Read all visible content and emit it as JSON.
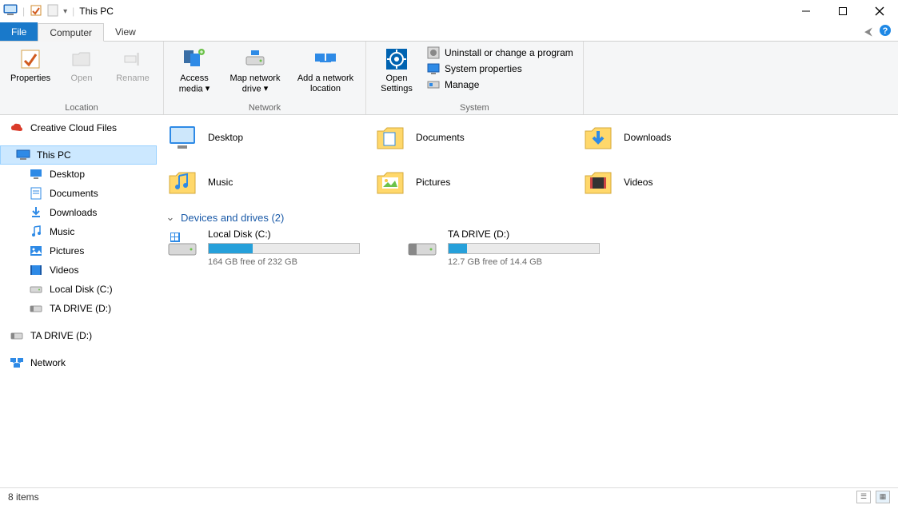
{
  "window": {
    "title": "This PC"
  },
  "tabs": {
    "file": "File",
    "computer": "Computer",
    "view": "View"
  },
  "ribbon": {
    "location": {
      "label": "Location",
      "properties": "Properties",
      "open": "Open",
      "rename": "Rename"
    },
    "network": {
      "label": "Network",
      "access_media": "Access media",
      "map_drive": "Map network drive",
      "add_location": "Add a network location"
    },
    "system": {
      "label": "System",
      "open_settings": "Open Settings",
      "uninstall": "Uninstall or change a program",
      "properties": "System properties",
      "manage": "Manage"
    }
  },
  "sidebar": {
    "creative_cloud": "Creative Cloud Files",
    "this_pc": "This PC",
    "desktop": "Desktop",
    "documents": "Documents",
    "downloads": "Downloads",
    "music": "Music",
    "pictures": "Pictures",
    "videos": "Videos",
    "local_disk": "Local Disk (C:)",
    "ta_drive": "TA DRIVE (D:)",
    "ta_drive_root": "TA DRIVE (D:)",
    "network": "Network"
  },
  "folders": [
    {
      "name": "Desktop"
    },
    {
      "name": "Documents"
    },
    {
      "name": "Downloads"
    },
    {
      "name": "Music"
    },
    {
      "name": "Pictures"
    },
    {
      "name": "Videos"
    }
  ],
  "drives_header": "Devices and drives (2)",
  "drives": [
    {
      "name": "Local Disk (C:)",
      "free_text": "164 GB free of 232 GB",
      "fill_pct": 29
    },
    {
      "name": "TA DRIVE (D:)",
      "free_text": "12.7 GB free of 14.4 GB",
      "fill_pct": 12
    }
  ],
  "status": {
    "item_count": "8 items"
  }
}
